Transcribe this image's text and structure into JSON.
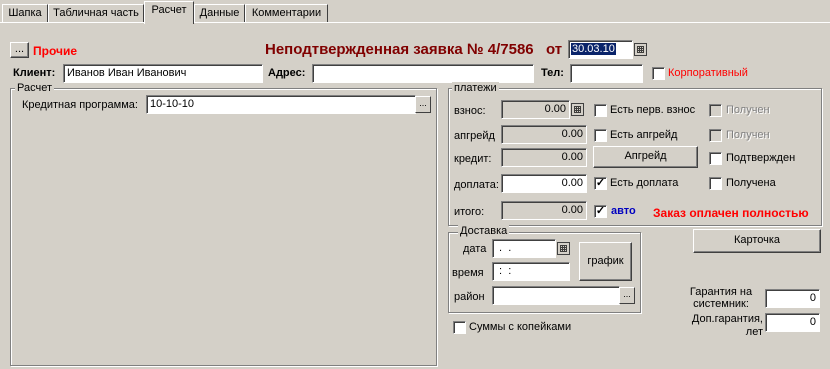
{
  "tabs": [
    "Шапка",
    "Табличная часть",
    "Расчет",
    "Данные",
    "Комментарии"
  ],
  "header": {
    "dots_button": "...",
    "other_label": "Прочие",
    "title": "Неподтвержденная заявка №  4/7586",
    "from_label": "от",
    "date_value": "30.03.10"
  },
  "client": {
    "client_label": "Клиент:",
    "client_value": "Иванов Иван Иванович",
    "address_label": "Адрес:",
    "address_value": "",
    "phone_label": "Тел:",
    "phone_value": "",
    "corporate_label": "Корпоративный"
  },
  "calc": {
    "group_title": "Расчет",
    "credit_program_label": "Кредитная программа:",
    "credit_program_value": "10-10-10",
    "credit_program_button": "..."
  },
  "payments": {
    "group_title": "платежи",
    "deposit_label": "взнос:",
    "deposit_value": "0.00",
    "has_first_deposit_label": "Есть перв. взнос",
    "received_label_1": "Получен",
    "upgrade_label": "апгрейд",
    "upgrade_value": "0.00",
    "has_upgrade_label": "Есть апгрейд",
    "received_label_2": "Получен",
    "credit_label": "кредит:",
    "credit_value": "0.00",
    "upgrade_button": "Апгрейд",
    "confirmed_label": "Подтвержден",
    "surcharge_label": "доплата:",
    "surcharge_value": "0.00",
    "has_surcharge_label": "Есть доплата",
    "has_surcharge_checked": true,
    "received_label_3": "Получена",
    "total_label": "итого:",
    "total_value": "0.00",
    "auto_label": "авто",
    "auto_checked": true,
    "paid_status": "Заказ оплачен полностью"
  },
  "delivery": {
    "group_title": "Доставка",
    "date_label": "дата",
    "date_value": " .  .",
    "time_label": "время",
    "time_value": " :  :",
    "schedule_button": "график",
    "district_label": "район",
    "district_value": "",
    "district_button": "..."
  },
  "card_button": "Карточка",
  "kopecks_label": "Суммы с копейками",
  "warranty": {
    "system_label": "Гарантия на системник:",
    "system_value": "0",
    "extra_label": "Доп.гарантия, лет",
    "extra_value": "0"
  },
  "colors": {
    "title": "#800000",
    "red": "#ff0000",
    "blue": "#0000c0",
    "face": "#d4d0c8"
  }
}
